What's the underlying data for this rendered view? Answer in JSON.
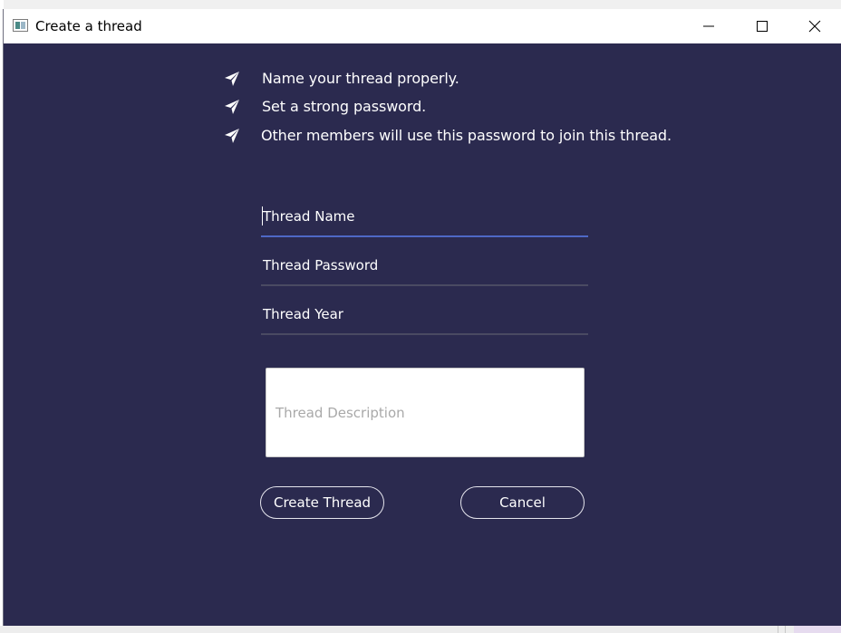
{
  "window": {
    "title": "Create a thread"
  },
  "tips": [
    {
      "icon": "paper-plane-icon",
      "text": "Name your thread properly."
    },
    {
      "icon": "paper-plane-icon",
      "text": "Set a strong password."
    },
    {
      "icon": "paper-plane-icon",
      "text": "Other members will use this password to join this thread."
    }
  ],
  "form": {
    "thread_name": {
      "placeholder": "Thread Name",
      "value": ""
    },
    "thread_password": {
      "placeholder": "Thread Password",
      "value": ""
    },
    "thread_year": {
      "placeholder": "Thread Year",
      "value": ""
    },
    "thread_description": {
      "placeholder": "Thread Description",
      "value": ""
    }
  },
  "actions": {
    "create_label": "Create Thread",
    "cancel_label": "Cancel"
  },
  "colors": {
    "background": "#2b2a4f",
    "active_underline": "#4e68c6",
    "text": "#ffffff"
  }
}
